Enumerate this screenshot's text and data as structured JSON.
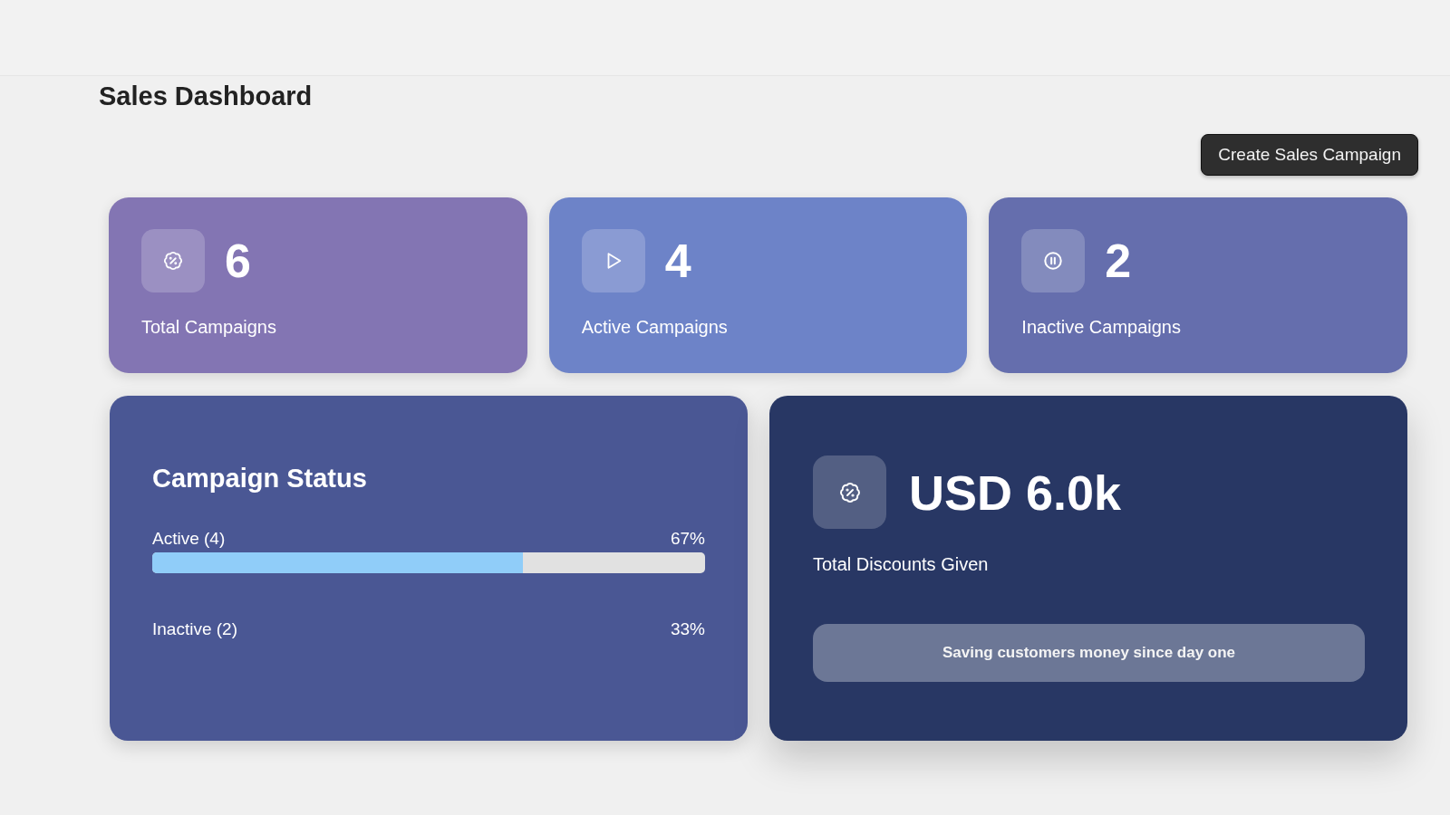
{
  "header": {
    "title": "Sales Dashboard"
  },
  "actions": {
    "create_button": "Create Sales Campaign"
  },
  "stat_cards": [
    {
      "kind": "total",
      "value": "6",
      "label": "Total Campaigns"
    },
    {
      "kind": "active",
      "value": "4",
      "label": "Active Campaigns"
    },
    {
      "kind": "inactive",
      "value": "2",
      "label": "Inactive Campaigns"
    }
  ],
  "campaign_status": {
    "title": "Campaign Status",
    "rows": [
      {
        "label": "Active (4)",
        "percent": "67%",
        "level": 0.67
      },
      {
        "label": "Inactive (2)",
        "percent": "33%"
      }
    ]
  },
  "discounts": {
    "value": "USD 6.0k",
    "label": "Total Discounts Given",
    "note": "Saving customers money since day one"
  }
}
